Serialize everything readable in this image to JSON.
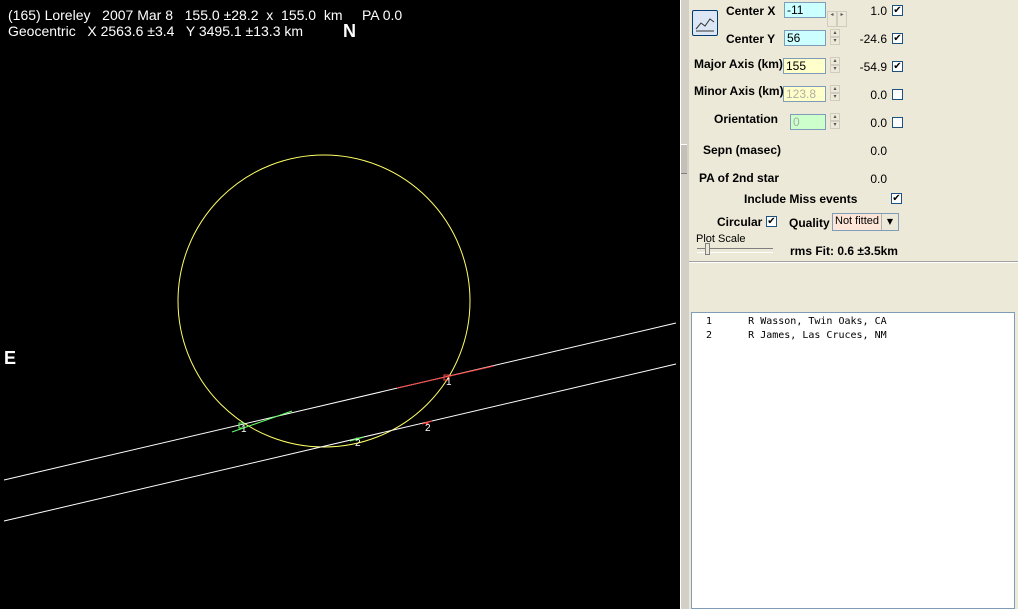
{
  "plot": {
    "title_line1": "(165) Loreley   2007 Mar 8   155.0 ±28.2  x  155.0  km     PA 0.0",
    "title_line2": "Geocentric   X 2563.6 ±3.4   Y 3495.1 ±13.3 km",
    "north": "N",
    "east": "E",
    "chord_labels": [
      "1",
      "1",
      "2",
      "2"
    ]
  },
  "panel": {
    "center_x": {
      "label": "Center X",
      "value": "-11",
      "fit": "1.0",
      "checked": true
    },
    "center_y": {
      "label": "Center Y",
      "value": "56",
      "fit": "-24.6",
      "checked": true
    },
    "major_axis": {
      "label": "Major Axis (km)",
      "value": "155",
      "fit": "-54.9",
      "checked": true
    },
    "minor_axis": {
      "label": "Minor Axis (km)",
      "value": "123.8",
      "fit": "0.0",
      "checked": false
    },
    "orientation": {
      "label": "Orientation",
      "value": "0",
      "fit": "0.0",
      "checked": false
    },
    "sepn": {
      "label": "Sepn (masec)",
      "value": "0.0"
    },
    "pa2": {
      "label": "PA of 2nd star",
      "value": "0.0"
    },
    "include_miss": {
      "label": "Include Miss events",
      "checked": true
    },
    "circular": {
      "label": "Circular",
      "checked": true
    },
    "quality": {
      "label": "Quality",
      "value": "Not fitted"
    },
    "plot_scale": "Plot Scale",
    "rms": "rms Fit: 0.6 ±3.5km"
  },
  "observers": [
    {
      "num": "1",
      "name": "R Wasson, Twin Oaks, CA"
    },
    {
      "num": "2",
      "name": "R James, Las Cruces, NM"
    }
  ],
  "colors": {
    "ellipse": "#ffff66",
    "chord": "#ffffff",
    "event1": "#66ff66",
    "event2": "#ff3333",
    "input_cyan": "#ccffff",
    "input_yellow": "#ffffcc",
    "input_green": "#ccffcc"
  }
}
